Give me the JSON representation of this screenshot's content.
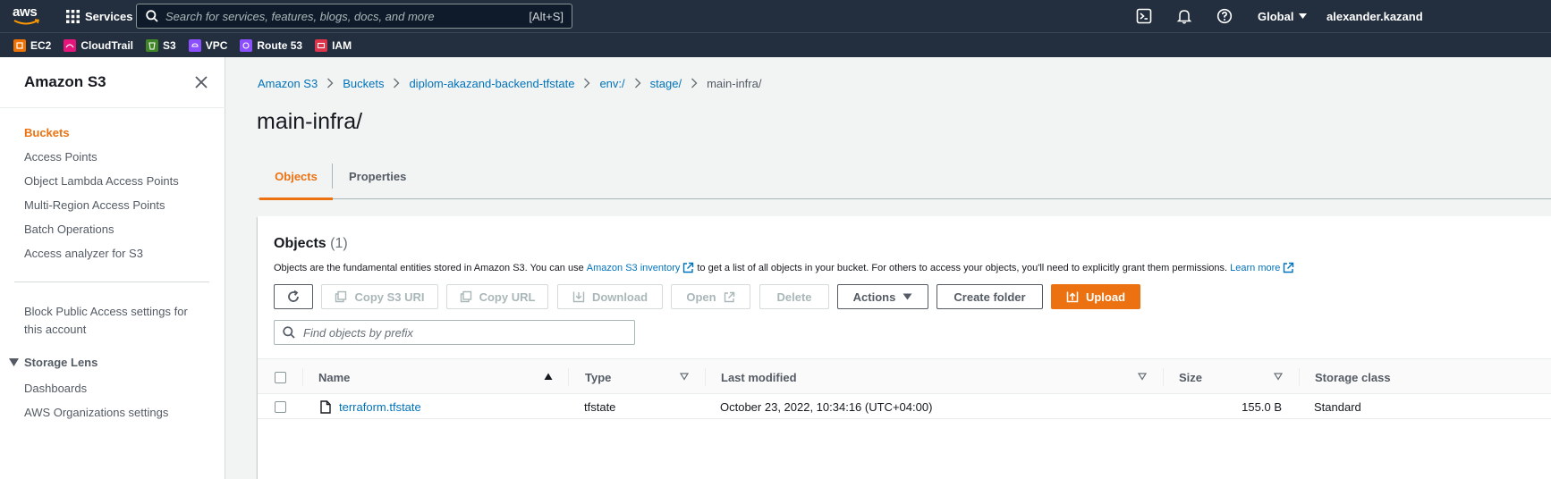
{
  "topnav": {
    "logo": "aws",
    "services_label": "Services",
    "search_placeholder": "Search for services, features, blogs, docs, and more",
    "search_shortcut": "[Alt+S]",
    "region": "Global",
    "account": "alexander.kazand"
  },
  "favorites": [
    {
      "label": "EC2",
      "color": "#ed7100",
      "icon": "ec2-icon"
    },
    {
      "label": "CloudTrail",
      "color": "#e7157b",
      "icon": "cloudtrail-icon"
    },
    {
      "label": "S3",
      "color": "#3f8624",
      "icon": "s3-icon"
    },
    {
      "label": "VPC",
      "color": "#8c4fff",
      "icon": "vpc-icon"
    },
    {
      "label": "Route 53",
      "color": "#8c4fff",
      "icon": "route53-icon"
    },
    {
      "label": "IAM",
      "color": "#dd344c",
      "icon": "iam-icon"
    }
  ],
  "sidebar": {
    "title": "Amazon S3",
    "items": [
      {
        "label": "Buckets",
        "active": true
      },
      {
        "label": "Access Points"
      },
      {
        "label": "Object Lambda Access Points"
      },
      {
        "label": "Multi-Region Access Points"
      },
      {
        "label": "Batch Operations"
      },
      {
        "label": "Access analyzer for S3"
      }
    ],
    "block_public": "Block Public Access settings for",
    "block_public_2": "this account",
    "storage_lens": {
      "title": "Storage Lens",
      "items": [
        {
          "label": "Dashboards"
        },
        {
          "label": "AWS Organizations settings"
        }
      ]
    }
  },
  "breadcrumbs": [
    {
      "label": "Amazon S3",
      "link": true
    },
    {
      "label": "Buckets",
      "link": true
    },
    {
      "label": "diplom-akazand-backend-tfstate",
      "link": true
    },
    {
      "label": "env:/",
      "link": true
    },
    {
      "label": "stage/",
      "link": true
    },
    {
      "label": "main-infra/",
      "link": false
    }
  ],
  "page_title": "main-infra/",
  "tabs": [
    {
      "label": "Objects",
      "active": true
    },
    {
      "label": "Properties",
      "active": false
    }
  ],
  "objects": {
    "title": "Objects",
    "count": "(1)",
    "desc_1": "Objects are the fundamental entities stored in Amazon S3. You can use",
    "desc_link": "Amazon S3 inventory",
    "desc_2": "to get a list of all objects in your bucket. For others to access your objects, you'll need to explicitly grant them permissions.",
    "learn_more": "Learn more",
    "buttons": {
      "copy_uri": "Copy S3 URI",
      "copy_url": "Copy URL",
      "download": "Download",
      "open": "Open",
      "delete": "Delete",
      "actions": "Actions",
      "create_folder": "Create folder",
      "upload": "Upload"
    },
    "filter_placeholder": "Find objects by prefix",
    "columns": [
      "Name",
      "Type",
      "Last modified",
      "Size",
      "Storage class"
    ],
    "rows": [
      {
        "name": "terraform.tfstate",
        "type": "tfstate",
        "last_modified": "October 23, 2022, 10:34:16 (UTC+04:00)",
        "size": "155.0 B",
        "storage_class": "Standard"
      }
    ]
  }
}
